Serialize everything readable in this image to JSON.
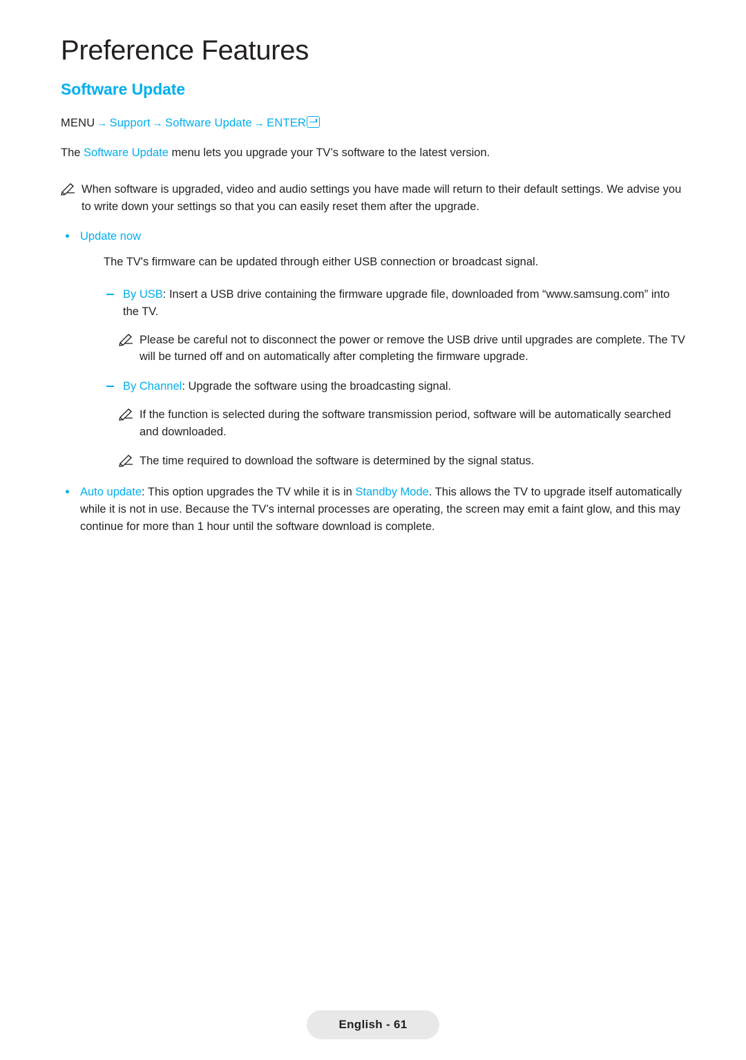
{
  "page": {
    "heading": "Preference Features",
    "section_title": "Software Update",
    "footer_label": "English - 61"
  },
  "menu_path": {
    "menu": "MENU",
    "arrow": "→",
    "support": "Support",
    "software_update": "Software Update",
    "enter": "ENTER",
    "enter_icon": "enter-key-icon"
  },
  "intro": {
    "part1": "The ",
    "link": "Software Update",
    "part2": " menu lets you upgrade your TV’s software to the latest version."
  },
  "notes": {
    "note1": "When software is upgraded, video and audio settings you have made will return to their default settings. We advise you to write down your settings so that you can easily reset them after the upgrade.",
    "note2": "Please be careful not to disconnect the power or remove the USB drive until upgrades are complete. The TV will be turned off and on automatically after completing the firmware upgrade.",
    "note3": "If the function is selected during the software transmission period, software will be automatically searched and downloaded.",
    "note4": "The time required to download the software is determined by the signal status."
  },
  "update_now": {
    "label": "Update now",
    "description": "The TV's firmware can be updated through either USB connection or broadcast signal.",
    "by_usb_label": "By USB",
    "by_usb_text": ": Insert a USB drive containing the firmware upgrade file, downloaded from “www.samsung.com” into the TV.",
    "by_channel_label": "By Channel",
    "by_channel_text": ": Upgrade the software using the broadcasting signal."
  },
  "auto_update": {
    "label": "Auto update",
    "text1": ": This option upgrades the TV while it is in ",
    "standby_mode": "Standby Mode",
    "text2": ". This allows the TV to upgrade itself automatically while it is not in use. Because the TV’s internal processes are operating, the screen may emit a faint glow, and this may continue for more than 1 hour until the software download is complete."
  },
  "colors": {
    "accent": "#00aeef",
    "text": "#231f20",
    "footer_bg": "#e8e8e8"
  }
}
